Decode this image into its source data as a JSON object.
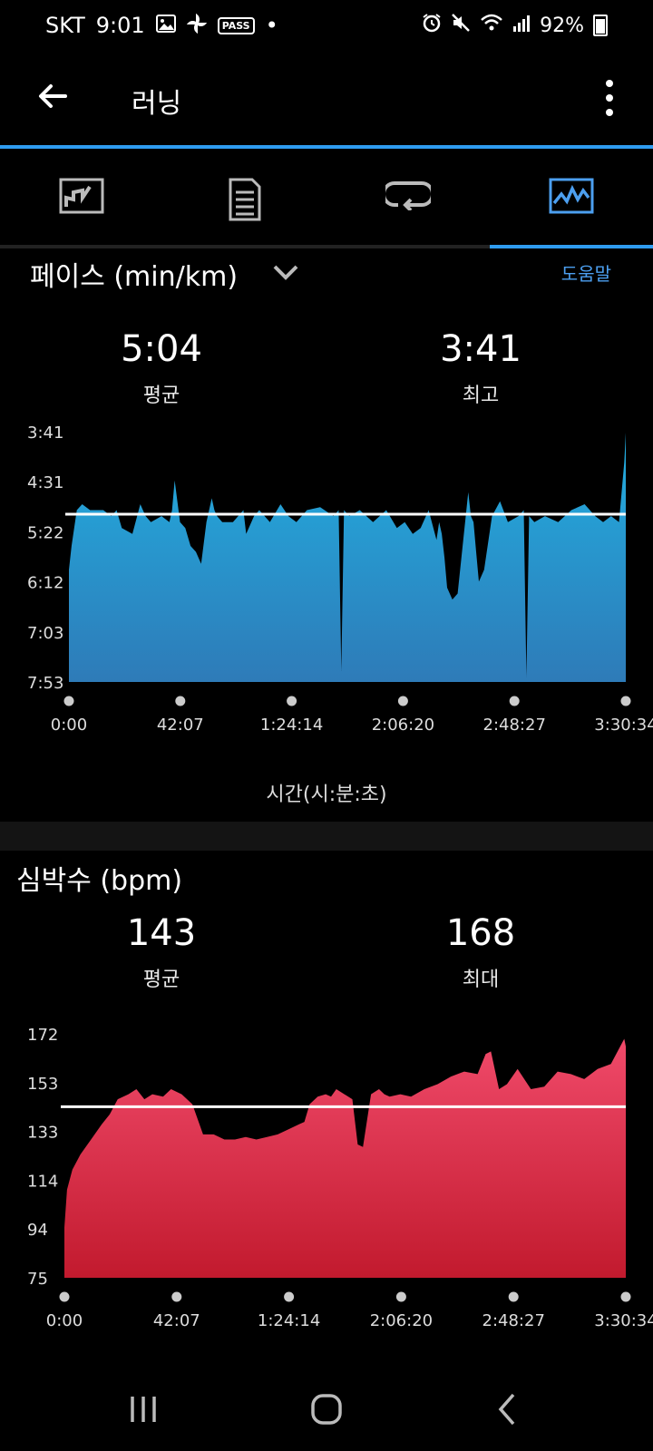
{
  "status_bar": {
    "carrier": "SKT",
    "time": "9:01",
    "pass_label": "PASS",
    "dot": "•",
    "battery": "92%",
    "icons": [
      "image-icon",
      "pinwheel-icon",
      "pass-icon",
      "alarm-icon",
      "mute-icon",
      "wifi-icon",
      "signal-icon",
      "battery-icon"
    ]
  },
  "appbar": {
    "title": "러닝",
    "back_icon": "arrow-left-icon",
    "menu_icon": "more-vertical-icon"
  },
  "tabs": [
    {
      "icon": "map-icon",
      "active": false
    },
    {
      "icon": "document-icon",
      "active": false
    },
    {
      "icon": "laps-icon",
      "active": false
    },
    {
      "icon": "chart-icon",
      "active": true
    }
  ],
  "colors": {
    "accent": "#2f9cf0",
    "pace_fill_top": "#22aee0",
    "pace_fill_bottom": "#2e7bb8",
    "hr_fill_top": "#f04a6a",
    "hr_fill_bottom": "#c21a2e"
  },
  "pace": {
    "title": "페이스 (min/km)",
    "help": "도움말",
    "avg_value": "5:04",
    "avg_label": "평균",
    "best_value": "3:41",
    "best_label": "최고",
    "x_caption": "시간(시:분:초)"
  },
  "hr": {
    "title": "심박수 (bpm)",
    "avg_value": "143",
    "avg_label": "평균",
    "max_value": "168",
    "max_label": "최대"
  },
  "chart_data": [
    {
      "type": "area",
      "ylabels": [
        "3:41",
        "4:31",
        "5:22",
        "6:12",
        "7:03",
        "7:53"
      ],
      "ylim": [
        3.683,
        7.883
      ],
      "y_inverted": true,
      "xlabels": [
        "0:00",
        "42:07",
        "1:24:14",
        "2:06:20",
        "2:48:27",
        "3:30:34"
      ],
      "xlim": [
        0,
        210.57
      ],
      "average": 5.067,
      "x": [
        0,
        1,
        3,
        5,
        8,
        10,
        13,
        16,
        18,
        20,
        24,
        27,
        28,
        29,
        31,
        35,
        38,
        39,
        40,
        42,
        44,
        46,
        48,
        50,
        52,
        54,
        55,
        56,
        58,
        62,
        66,
        67,
        68,
        70,
        72,
        76,
        80,
        83,
        86,
        90,
        95,
        100,
        102,
        103,
        104,
        106,
        110,
        115,
        120,
        124,
        127,
        130,
        133,
        136,
        139,
        140,
        141,
        142,
        143,
        145,
        147,
        151,
        152,
        153,
        154,
        155,
        157,
        160,
        163,
        166,
        170,
        172,
        173,
        174,
        176,
        180,
        185,
        190,
        195,
        199,
        202,
        205,
        208,
        210,
        210.57
      ],
      "y": [
        6.0,
        5.6,
        5.0,
        4.9,
        5.0,
        5.0,
        5.0,
        5.1,
        5.0,
        5.3,
        5.4,
        4.9,
        5.0,
        5.1,
        5.2,
        5.1,
        5.2,
        5.0,
        4.5,
        5.2,
        5.3,
        5.6,
        5.7,
        5.9,
        5.2,
        4.8,
        5.0,
        5.1,
        5.2,
        5.2,
        5.0,
        5.4,
        5.3,
        5.1,
        5.0,
        5.2,
        4.9,
        5.1,
        5.2,
        5.0,
        4.95,
        5.1,
        5.0,
        7.7,
        5.0,
        5.1,
        5.0,
        5.2,
        5.0,
        5.3,
        5.2,
        5.4,
        5.3,
        5.0,
        5.5,
        5.2,
        5.4,
        5.8,
        6.3,
        6.5,
        6.4,
        4.7,
        5.1,
        5.2,
        5.7,
        6.2,
        6.0,
        5.1,
        4.85,
        5.2,
        5.1,
        5.0,
        7.8,
        5.1,
        5.2,
        5.1,
        5.2,
        5.0,
        4.9,
        5.1,
        5.2,
        5.1,
        5.2,
        4.2,
        3.7
      ]
    },
    {
      "type": "area",
      "ylabels": [
        "172",
        "153",
        "133",
        "114",
        "94",
        "75"
      ],
      "ylim": [
        75,
        172
      ],
      "xlabels": [
        "0:00",
        "42:07",
        "1:24:14",
        "2:06:20",
        "2:48:27",
        "3:30:34"
      ],
      "xlim": [
        0,
        210.57
      ],
      "average": 143,
      "x": [
        0,
        1,
        3,
        6,
        10,
        14,
        17,
        20,
        24,
        27,
        30,
        33,
        37,
        40,
        44,
        48,
        50,
        52,
        56,
        60,
        64,
        68,
        72,
        76,
        80,
        84,
        88,
        90,
        92,
        95,
        98,
        100,
        102,
        105,
        108,
        110,
        112,
        115,
        118,
        120,
        122,
        126,
        130,
        135,
        140,
        145,
        150,
        155,
        158,
        160,
        163,
        166,
        170,
        175,
        180,
        185,
        190,
        195,
        200,
        205,
        210,
        210.57
      ],
      "y": [
        95,
        110,
        118,
        124,
        130,
        136,
        140,
        146,
        148,
        150,
        146,
        148,
        147,
        150,
        148,
        144,
        138,
        132,
        132,
        130,
        130,
        131,
        130,
        131,
        132,
        134,
        136,
        137,
        144,
        147,
        148,
        147,
        150,
        148,
        146,
        128,
        127,
        148,
        150,
        148,
        147,
        148,
        147,
        150,
        152,
        155,
        157,
        156,
        164,
        165,
        150,
        152,
        158,
        150,
        151,
        157,
        156,
        154,
        158,
        160,
        170,
        167
      ]
    }
  ],
  "axis_icons": {
    "dropdown": "chevron-down-icon"
  },
  "navbar": {
    "recents_icon": "recents-icon",
    "home_icon": "home-icon",
    "back_icon": "nav-back-icon"
  }
}
